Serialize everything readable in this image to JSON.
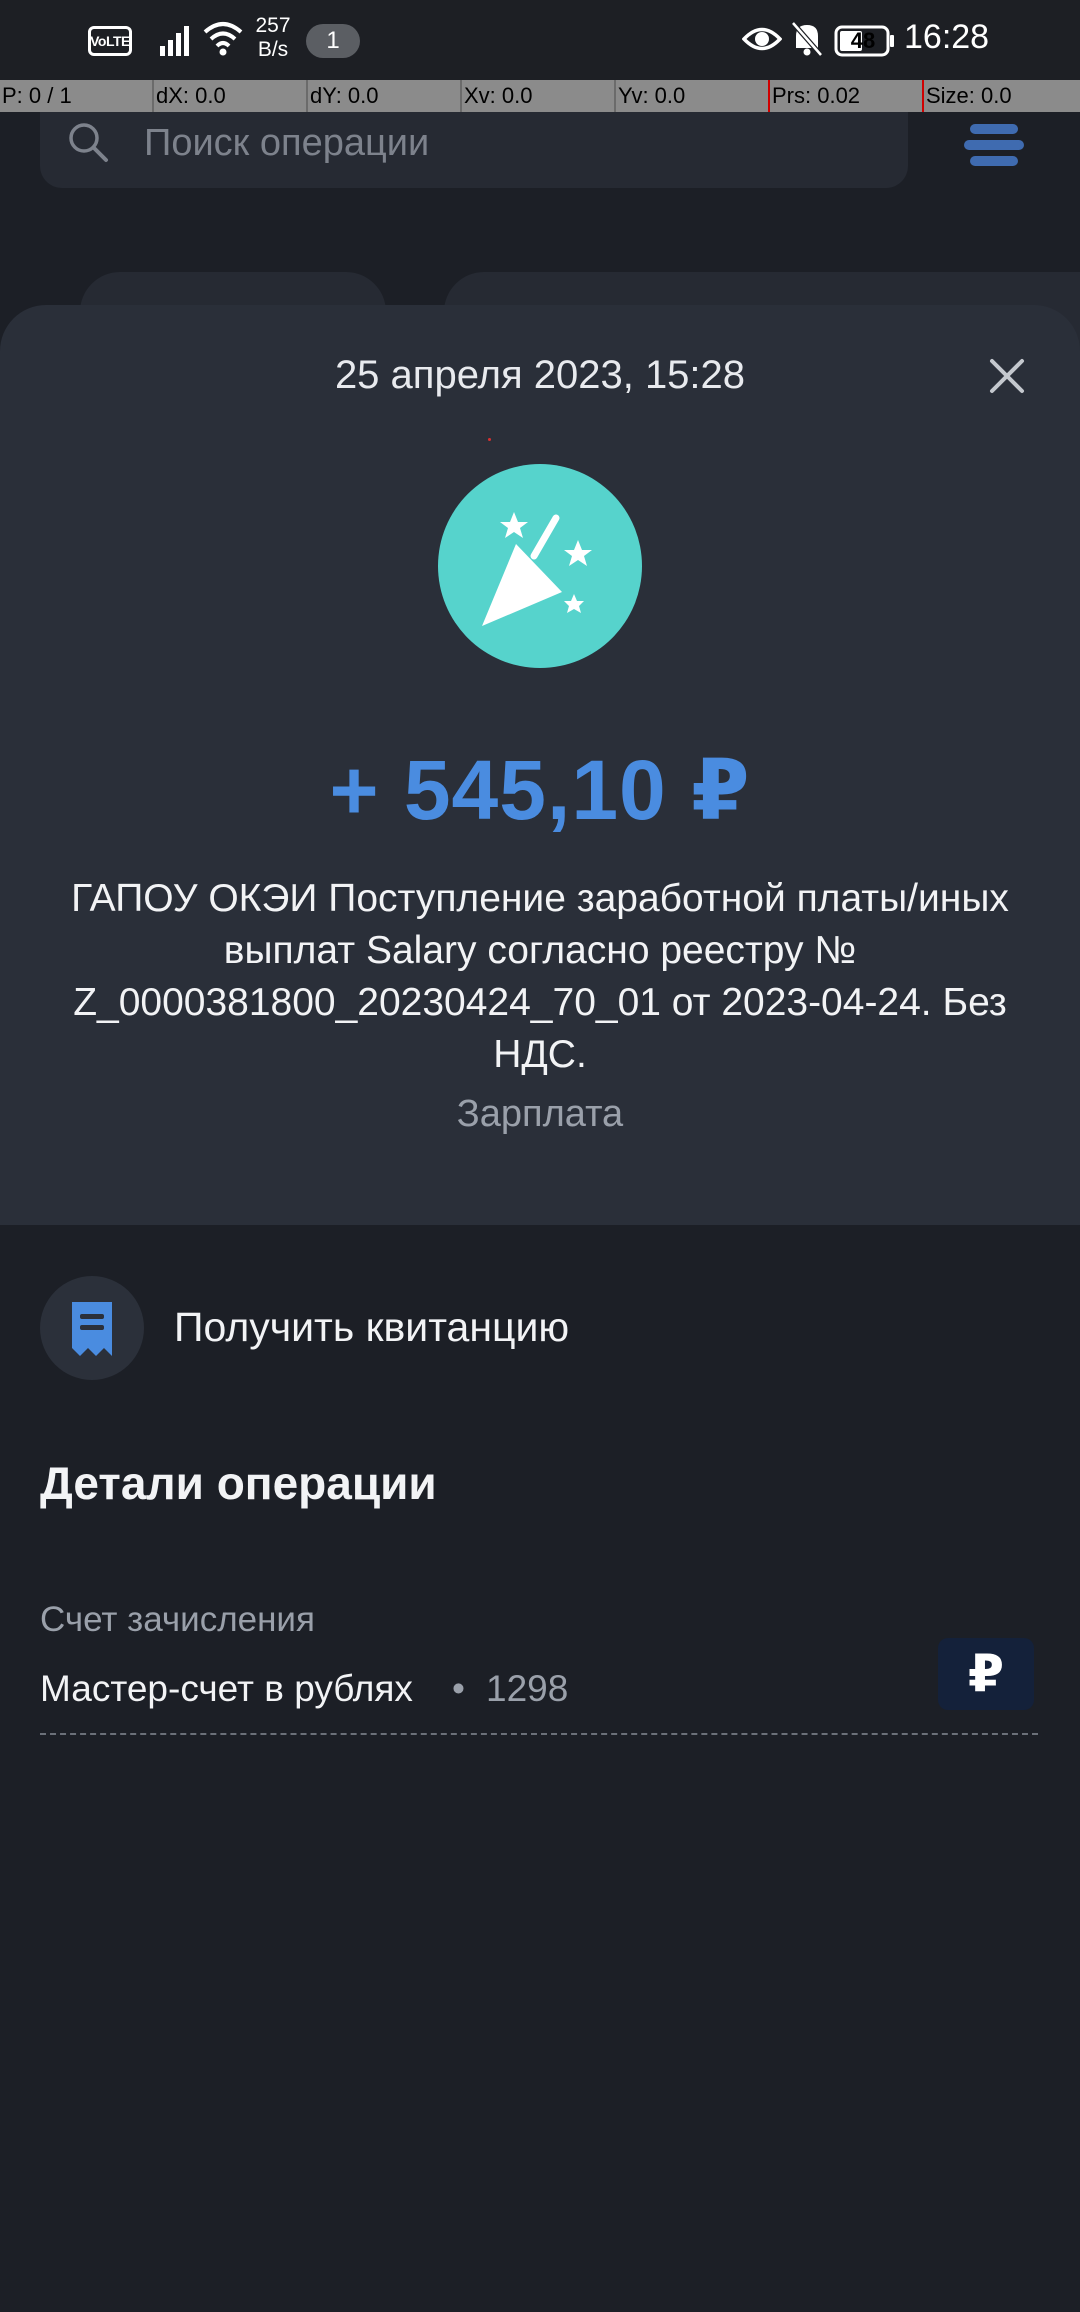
{
  "status_bar": {
    "volte": "VoLTE",
    "speed_value": "257",
    "speed_unit": "B/s",
    "notification_count": "1",
    "battery": "48",
    "time": "16:28"
  },
  "debug_bar": {
    "pointer": "P: 0 / 1",
    "dx": "dX: 0.0",
    "dy": "dY: 0.0",
    "xv": "Xv: 0.0",
    "yv": "Yv: 0.0",
    "prs": "Prs: 0.02",
    "size": "Size: 0.0"
  },
  "background": {
    "search_placeholder": "Поиск операции"
  },
  "sheet": {
    "date": "25 апреля 2023, 15:28",
    "category_icon": "party-popper-icon",
    "category_color": "#56d3cc",
    "amount": "+ 545,10 ₽",
    "amount_color": "#4a8ce0",
    "description": "ГАПОУ ОКЭИ Поступление заработной платы/иных выплат Salary согласно реестру № Z_0000381800_20230424_70_01 от 2023-04-24. Без НДС.",
    "category": "Зарплата"
  },
  "actions": {
    "receipt_label": "Получить квитанцию"
  },
  "details": {
    "title": "Детали операции",
    "account_label": "Счет зачисления",
    "account_name": "Мастер-счет в рублях",
    "account_separator": "•",
    "account_number": "1298",
    "account_currency_symbol": "₽"
  }
}
